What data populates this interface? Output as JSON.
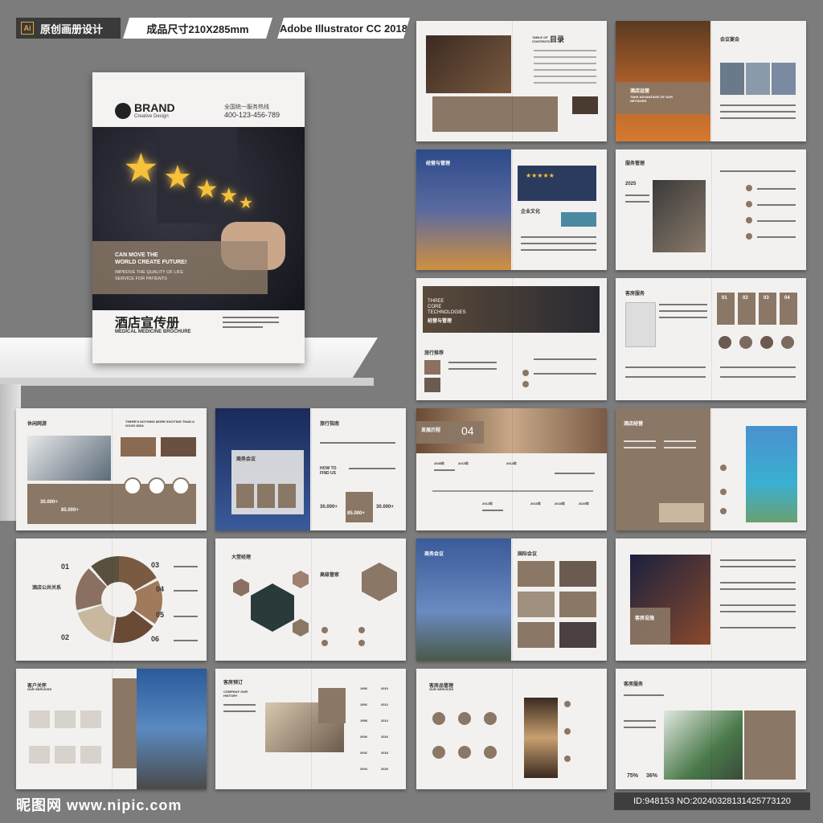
{
  "header": {
    "tag1": "原创画册设计",
    "tag2": "成品尺寸210X285mm",
    "tag3": "Adobe Illustrator CC 2018",
    "ai_icon": "Ai"
  },
  "cover": {
    "brand": "BRAND",
    "brand_sub": "Creative Design",
    "hotline_label": "全国统一服务热线",
    "hotline": "400-123-456-789",
    "slogan1": "CAN MOVE THE",
    "slogan2": "WORLD CREATE FUTURE!",
    "slogan3": "IMPROVE THE QUALITY OF LIFE",
    "slogan4": "SERVICE FOR PATIENTS",
    "title_cn": "酒店宣传册",
    "title_en": "MEDICAL MEDICINE BROCHURE"
  },
  "spreads": {
    "s1_title": "目录",
    "s1_sub": "TABLE OF CONTENTS",
    "s2_title": "会议宴会",
    "s2_box": "酒店运营",
    "s2_box_en": "TAKE ADVANTAGE OF OUR NETWORK",
    "s3_title": "经营与管理",
    "s3_rating": "★★★★★",
    "s3_sub": "企业文化",
    "s4_title": "服务管理",
    "s4_year": "2025",
    "s5_title1": "THREE",
    "s5_title2": "CORE",
    "s5_title3": "TECHNOLOGIES",
    "s5_title4": "经营与管理",
    "s5_sub": "旅行推荐",
    "s6_title": "客房服务",
    "s6_nums": [
      "01",
      "02",
      "03",
      "04"
    ],
    "s7_title": "休闲网游",
    "s7_en": "THERE'S NOTHING MORE EXCITING THAN A GOOD IDEA",
    "s7_n1": "30.000+",
    "s7_n2": "85.000+",
    "s8_title": "商务会议",
    "s8_title2": "旅行指南",
    "s8_find": "HOW TO FIND US",
    "s8_n1": "30.000+",
    "s8_n2": "85.000+",
    "s8_n3": "30.000+",
    "s9_title": "发展历程",
    "s9_num": "04",
    "s9_years": [
      "2008年",
      "2010年",
      "2012年",
      "2014年",
      "2016年",
      "2018年",
      "2020年"
    ],
    "s10_title": "酒店经营",
    "s11_title": "酒店公共关系",
    "s11_nums": [
      "01",
      "02",
      "03",
      "04",
      "05",
      "06"
    ],
    "s12_title": "大堂经理",
    "s12_title2": "高级管家",
    "s13_title": "商务会议",
    "s13_title2": "国际会议",
    "s14_title": "客房设施",
    "s15_title": "客户关怀",
    "s15_en": "OUR SERVICES",
    "s16_title": "客房预订",
    "s16_en": "COMPANY OUR HISTORY",
    "s16_years": [
      "1990",
      "2010",
      "1992",
      "2012",
      "1998",
      "2014",
      "2000",
      "2016",
      "2002",
      "2018",
      "2004",
      "2020"
    ],
    "s17_title": "客房品管理",
    "s17_en": "OUR SERVICES",
    "s18_title": "客房服务",
    "s18_p1": "75%",
    "s18_p2": "36%"
  },
  "footer": {
    "logo": "昵图网 www.nipic.com",
    "id": "ID:948153 NO:20240328131425773120"
  },
  "colors": {
    "accent": "#8b7765",
    "background": "#7c7c7c",
    "paper": "#f2f1ef"
  }
}
